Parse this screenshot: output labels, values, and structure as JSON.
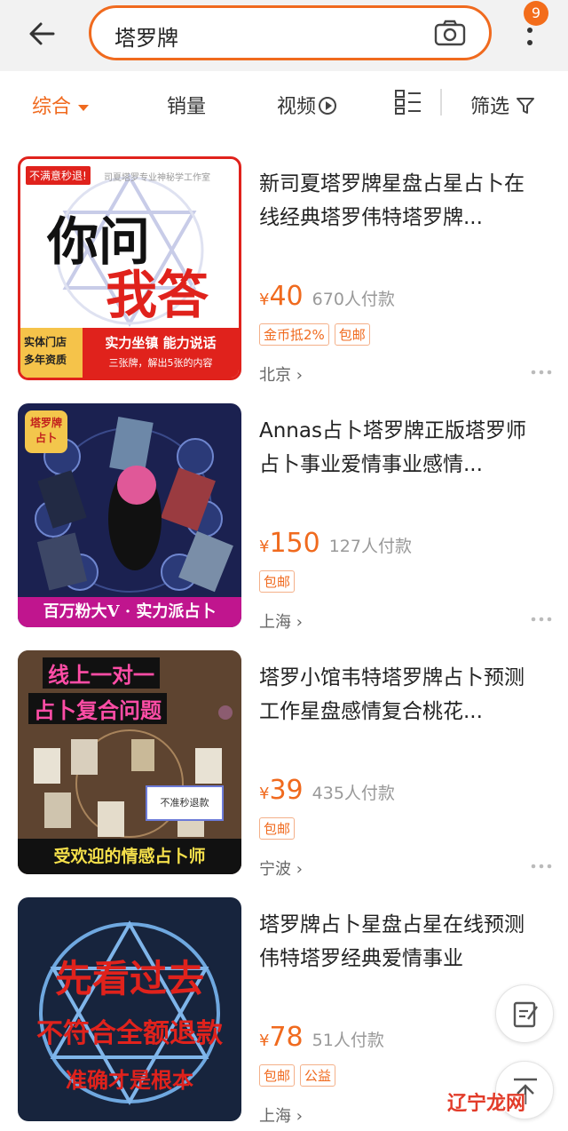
{
  "header": {
    "search_query": "塔罗牌",
    "cart_badge": "9"
  },
  "filters": {
    "comprehensive": "综合",
    "sales": "销量",
    "video": "视频",
    "filter": "筛选"
  },
  "products": [
    {
      "title": "新司夏塔罗牌星盘占星占卜在线经典塔罗伟特塔罗牌...",
      "price_symbol": "¥",
      "price": "40",
      "sales": "670人付款",
      "tags": [
        "金币抵2%",
        "包邮"
      ],
      "location": "北京 ›",
      "thumb": {
        "badge": "不满意秒退!",
        "studio": "司夏塔罗专业神秘学工作室",
        "big1": "你问",
        "big2": "我答",
        "side": "实体门店 多年资质",
        "strap1": "实力坐镇 能力说话",
        "strap2": "三张牌，解出5张的内容"
      }
    },
    {
      "title": "Annas占卜塔罗牌正版塔罗师占卜事业爱情事业感情...",
      "price_symbol": "¥",
      "price": "150",
      "sales": "127人付款",
      "tags": [
        "包邮"
      ],
      "location": "上海 ›",
      "thumb": {
        "corner": "塔罗牌 占卜",
        "bottom": "百万粉大V · 实力派占卜"
      }
    },
    {
      "title": "塔罗小馆韦特塔罗牌占卜预测工作星盘感情复合桃花...",
      "price_symbol": "¥",
      "price": "39",
      "sales": "435人付款",
      "tags": [
        "包邮"
      ],
      "location": "宁波 ›",
      "thumb": {
        "top1": "线上一对一",
        "top2": "占卜复合问题",
        "mid": "不准秒退款",
        "bottom": "受欢迎的情感占卜师"
      }
    },
    {
      "title": "塔罗牌占卜星盘占星在线预测伟特塔罗经典爱情事业",
      "price_symbol": "¥",
      "price": "78",
      "sales": "51人付款",
      "tags": [
        "包邮",
        "公益"
      ],
      "location": "上海 ›",
      "thumb": {
        "line1": "先看过去",
        "line2": "不符合全额退款",
        "line3": "准确才是根本"
      }
    }
  ],
  "watermark": "辽宁龙网",
  "colors": {
    "accent": "#f06a1e",
    "badge": "#f36d1b"
  }
}
